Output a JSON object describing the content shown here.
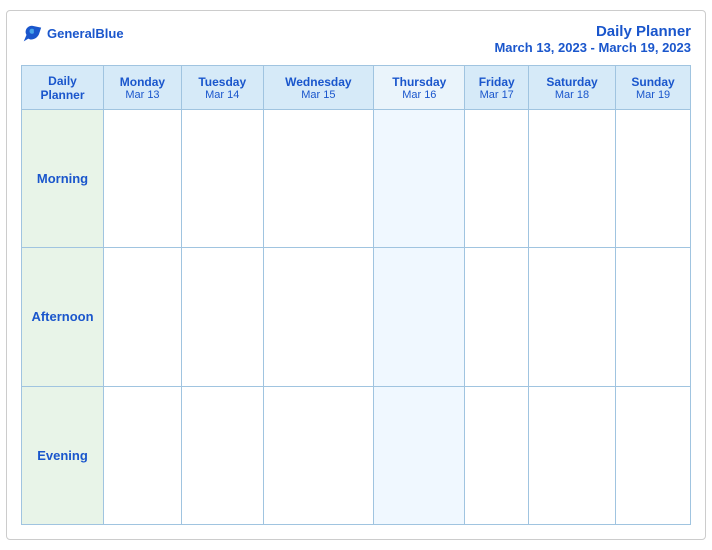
{
  "header": {
    "logo": {
      "general": "General",
      "blue": "Blue",
      "bird_symbol": "▶"
    },
    "title": "Daily Planner",
    "date_range": "March 13, 2023 - March 19, 2023"
  },
  "columns": [
    {
      "id": "label",
      "name": "Daily\nPlanner",
      "date": ""
    },
    {
      "id": "mon",
      "name": "Monday",
      "date": "Mar 13"
    },
    {
      "id": "tue",
      "name": "Tuesday",
      "date": "Mar 14"
    },
    {
      "id": "wed",
      "name": "Wednesday",
      "date": "Mar 15"
    },
    {
      "id": "thu",
      "name": "Thursday",
      "date": "Mar 16"
    },
    {
      "id": "fri",
      "name": "Friday",
      "date": "Mar 17"
    },
    {
      "id": "sat",
      "name": "Saturday",
      "date": "Mar 18"
    },
    {
      "id": "sun",
      "name": "Sunday",
      "date": "Mar 19"
    }
  ],
  "rows": [
    {
      "id": "morning",
      "label": "Morning"
    },
    {
      "id": "afternoon",
      "label": "Afternoon"
    },
    {
      "id": "evening",
      "label": "Evening"
    }
  ]
}
